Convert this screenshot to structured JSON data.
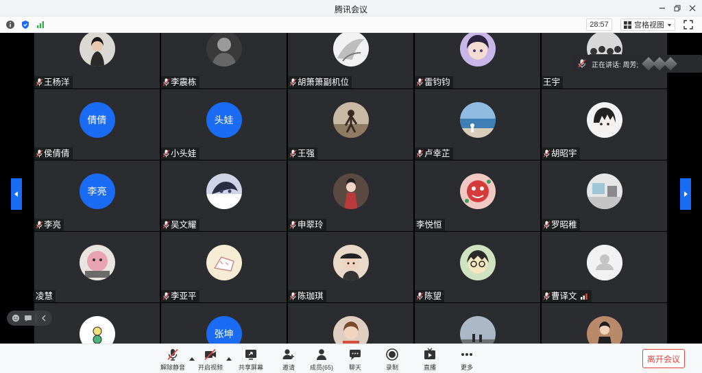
{
  "window": {
    "title": "腾讯会议"
  },
  "infobar": {
    "timer": "28:57",
    "view_label": "宫格视图"
  },
  "toast": {
    "text": "正在讲话: 周芳;"
  },
  "participants": [
    {
      "name": "王杨洋",
      "mic": true,
      "avatar": "photo-portrait-woman"
    },
    {
      "name": "李震栋",
      "mic": true,
      "avatar": "photo-dark"
    },
    {
      "name": "胡箫箫副机位",
      "mic": true,
      "avatar": "photo-sketch"
    },
    {
      "name": "雷钧钧",
      "mic": true,
      "avatar": "anime-purple"
    },
    {
      "name": "王宇",
      "mic": false,
      "avatar": "photo-crowd"
    },
    {
      "name": "侯倩倩",
      "mic": true,
      "avatar_text": "倩倩"
    },
    {
      "name": "小头娃",
      "mic": true,
      "avatar_text": "头娃"
    },
    {
      "name": "王强",
      "mic": true,
      "avatar": "photo-dancer"
    },
    {
      "name": "卢幸芷",
      "mic": true,
      "avatar": "photo-sea"
    },
    {
      "name": "胡昭宇",
      "mic": true,
      "avatar": "anime-boy"
    },
    {
      "name": "李亮",
      "mic": true,
      "avatar_text": "李亮"
    },
    {
      "name": "吴文耀",
      "mic": true,
      "avatar": "anime-face"
    },
    {
      "name": "申翠玲",
      "mic": true,
      "avatar": "photo-doll"
    },
    {
      "name": "李悦恒",
      "mic": false,
      "avatar": "cartoon-red"
    },
    {
      "name": "罗昭稚",
      "mic": true,
      "avatar": "photo-room"
    },
    {
      "name": "凌慧",
      "mic": false,
      "avatar": "photo-pink-creature"
    },
    {
      "name": "李亚平",
      "mic": true,
      "avatar": "sketch-cat"
    },
    {
      "name": "陈珈琪",
      "mic": true,
      "avatar": "photo-girl-hat"
    },
    {
      "name": "陈望",
      "mic": true,
      "avatar": "cartoon-glasses"
    },
    {
      "name": "曹译文",
      "mic": true,
      "avatar": "default-user",
      "signal": true
    },
    {
      "name": "",
      "mic": false,
      "avatar": "sticker-bird"
    },
    {
      "name": "",
      "mic": false,
      "avatar_text": "张坤"
    },
    {
      "name": "",
      "mic": false,
      "avatar": "photo-girl-child"
    },
    {
      "name": "",
      "mic": false,
      "avatar": "photo-sky-people"
    },
    {
      "name": "",
      "mic": false,
      "avatar": "photo-woman-coat"
    }
  ],
  "toolbar": {
    "unmute": "解除静音",
    "start_video": "开启视频",
    "share_screen": "共享屏幕",
    "invite": "邀请",
    "members": "成员(65)",
    "chat": "聊天",
    "record": "录制",
    "live": "直播",
    "more": "更多",
    "leave": "离开会议"
  },
  "colors": {
    "accent": "#1a6cf5",
    "leave": "#e0473f",
    "tile": "#2b2c2f"
  }
}
